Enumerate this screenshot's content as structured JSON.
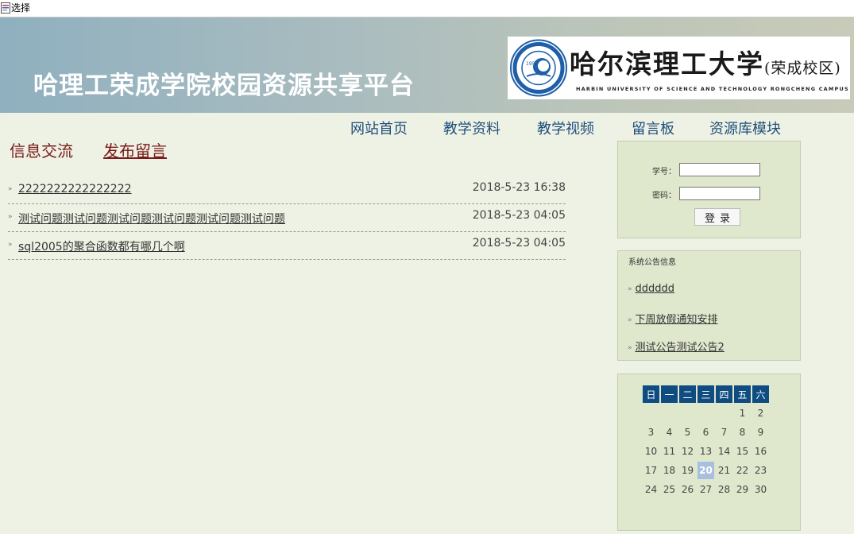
{
  "window": {
    "title": "选择"
  },
  "banner": {
    "site_title": "哈理工荣成学院校园资源共享平台",
    "logo_cn": "哈尔滨理工大学",
    "logo_campus": "(荣成校区)",
    "logo_en": "HARBIN UNIVERSITY OF SCIENCE AND TECHNOLOGY RONGCHENG CAMPUS",
    "seal_year": "1950"
  },
  "nav": {
    "items": [
      "网站首页",
      "教学资料",
      "教学视频",
      "留言板",
      "资源库模块"
    ]
  },
  "main": {
    "tab_info": "信息交流",
    "tab_post": "发布留言",
    "messages": [
      {
        "title": "2222222222222222",
        "time": "2018-5-23 16:38"
      },
      {
        "title": "测试问题测试问题测试问题测试问题测试问题测试问题",
        "time": "2018-5-23 04:05"
      },
      {
        "title": "sql2005的聚合函数都有哪几个啊",
        "time": "2018-5-23 04:05"
      }
    ]
  },
  "login": {
    "student_id_label": "学号：",
    "student_id_value": "",
    "password_label": "密码：",
    "password_value": "",
    "submit_label": "登录"
  },
  "notices": {
    "title": "系统公告信息",
    "items": [
      "dddddd",
      "下周放假通知安排",
      "测试公告测试公告2"
    ]
  },
  "calendar": {
    "weekdays": [
      "日",
      "一",
      "二",
      "三",
      "四",
      "五",
      "六"
    ],
    "weeks": [
      [
        "",
        "",
        "",
        "",
        "",
        "1",
        "2"
      ],
      [
        "3",
        "4",
        "5",
        "6",
        "7",
        "8",
        "9"
      ],
      [
        "10",
        "11",
        "12",
        "13",
        "14",
        "15",
        "16"
      ],
      [
        "17",
        "18",
        "19",
        "20",
        "21",
        "22",
        "23"
      ],
      [
        "24",
        "25",
        "26",
        "27",
        "28",
        "29",
        "30"
      ]
    ],
    "today": "20"
  },
  "colors": {
    "nav_link": "#1f4e7c",
    "heading": "#7a1a1a",
    "calendar_header": "#0f4c81",
    "calendar_today": "#a9bfe0",
    "panel_bg": "#dfe7cc"
  },
  "icons": {
    "app": "app-window-icon",
    "bullet": "double-arrow-bullet-icon",
    "seal": "university-seal-icon"
  }
}
